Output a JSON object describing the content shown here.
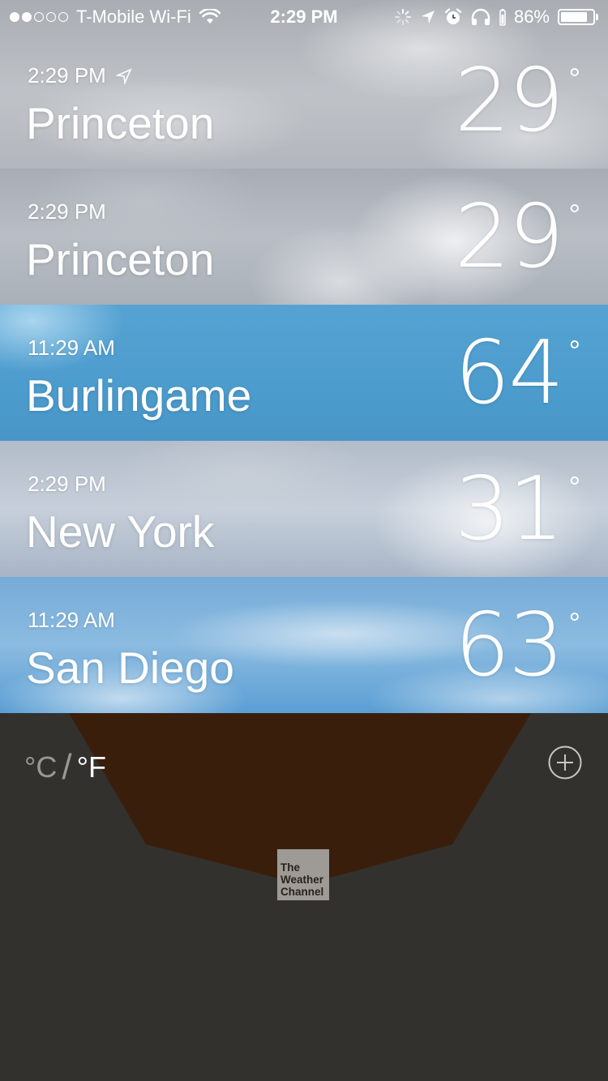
{
  "status_bar": {
    "signal_dots_on": 2,
    "signal_dots_total": 5,
    "carrier": "T-Mobile Wi-Fi",
    "time": "2:29 PM",
    "battery_percent": "86%",
    "battery_level": 0.86,
    "icons": [
      "wifi-icon",
      "activity-spinner-icon",
      "location-arrow-icon",
      "alarm-icon",
      "headphones-icon",
      "battery-icon"
    ]
  },
  "cities": [
    {
      "time": "2:29 PM",
      "name": "Princeton",
      "temp": "29",
      "degree": "°",
      "current_location": true
    },
    {
      "time": "2:29 PM",
      "name": "Princeton",
      "temp": "29",
      "degree": "°",
      "current_location": false
    },
    {
      "time": "11:29 AM",
      "name": "Burlingame",
      "temp": "64",
      "degree": "°",
      "current_location": false
    },
    {
      "time": "2:29 PM",
      "name": "New York",
      "temp": "31",
      "degree": "°",
      "current_location": false
    },
    {
      "time": "11:29 AM",
      "name": "San Diego",
      "temp": "63",
      "degree": "°",
      "current_location": false
    }
  ],
  "footer": {
    "unit_c": "°C",
    "unit_separator": "/",
    "unit_f": "°F",
    "selected_unit": "F",
    "add_icon": "plus-circle-icon",
    "logo_lines": [
      "The",
      "Weather",
      "Channel"
    ]
  },
  "colors": {
    "footer_bg": "#33312e",
    "footer_shape": "#3a1e0c",
    "sunny_blue": "#4c9ccd",
    "logo_bg": "#9e9b97"
  }
}
